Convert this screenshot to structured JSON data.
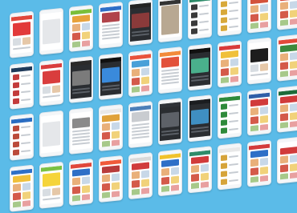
{
  "screens": [
    {
      "t": "promo",
      "bar": "#e0473b",
      "accent": "#e23a3a"
    },
    {
      "t": "blank",
      "bar": "#ffffff",
      "accent": "#e5e7ea"
    },
    {
      "t": "catalog",
      "bar": "#7bbf3a",
      "accent": "#e8a23a"
    },
    {
      "t": "article",
      "bar": "#2e6fc7",
      "accent": "#b0434a"
    },
    {
      "t": "video",
      "bar": "#222222",
      "accent": "#8a3a3a"
    },
    {
      "t": "photo",
      "bar": "#333333",
      "accent": "#b8a892"
    },
    {
      "t": "list",
      "bar": "#2e8c6a",
      "accent": "#3a3a3a"
    },
    {
      "t": "list",
      "bar": "#3d7fd4",
      "accent": "#d8a93a"
    },
    {
      "t": "catalog",
      "bar": "#2c64b8",
      "accent": "#d3523b"
    },
    {
      "t": "catalog",
      "bar": "#f0c22c",
      "accent": "#d64b3b"
    },
    {
      "t": "list",
      "bar": "#1f3a5a",
      "accent": "#c33b3b"
    },
    {
      "t": "promo",
      "bar": "#d93d3d",
      "accent": "#d93d3d"
    },
    {
      "t": "video",
      "bar": "#2a2a2a",
      "accent": "#7b7b7b"
    },
    {
      "t": "dark",
      "bar": "#111111",
      "accent": "#3a8adb"
    },
    {
      "t": "catalog",
      "bar": "#e8533c",
      "accent": "#4aa0d8"
    },
    {
      "t": "article",
      "bar": "#f28a3a",
      "accent": "#e2523b"
    },
    {
      "t": "dark",
      "bar": "#111111",
      "accent": "#4ab08c"
    },
    {
      "t": "catalog",
      "bar": "#d83b3b",
      "accent": "#f0c03a"
    },
    {
      "t": "promo",
      "bar": "#ffffff",
      "accent": "#1d1d1d"
    },
    {
      "t": "catalog",
      "bar": "#e24a3a",
      "accent": "#3d8a3d"
    },
    {
      "t": "list",
      "bar": "#2a6dc2",
      "accent": "#bb4a3a"
    },
    {
      "t": "blank",
      "bar": "#ffffff",
      "accent": "#e5e7ea"
    },
    {
      "t": "article",
      "bar": "#ffffff",
      "accent": "#8a8a8a"
    },
    {
      "t": "catalog",
      "bar": "#e8e8e8",
      "accent": "#e0a23a"
    },
    {
      "t": "article",
      "bar": "#4d7fb8",
      "accent": "#c9ccd0"
    },
    {
      "t": "dark",
      "bar": "#2f3338",
      "accent": "#5d6168"
    },
    {
      "t": "dark",
      "bar": "#1b1d20",
      "accent": "#3f8fc2"
    },
    {
      "t": "list",
      "bar": "#2e8a3a",
      "accent": "#2e8a3a"
    },
    {
      "t": "catalog",
      "bar": "#2f5fa8",
      "accent": "#d13b3b"
    },
    {
      "t": "catalog",
      "bar": "#1d6b3a",
      "accent": "#d13b3b"
    },
    {
      "t": "catalog",
      "bar": "#2e6fc7",
      "accent": "#f0c03a"
    },
    {
      "t": "promo",
      "bar": "#7ac143",
      "accent": "#f5d43a"
    },
    {
      "t": "catalog",
      "bar": "#e0473b",
      "accent": "#2e6fc7"
    },
    {
      "t": "catalog",
      "bar": "#f05a3a",
      "accent": "#b83b3b"
    },
    {
      "t": "catalog",
      "bar": "#d9d9d9",
      "accent": "#d13b3b"
    },
    {
      "t": "catalog",
      "bar": "#f0c22c",
      "accent": "#2e6fc7"
    },
    {
      "t": "catalog",
      "bar": "#2e8c6a",
      "accent": "#d13b3b"
    },
    {
      "t": "list",
      "bar": "#e8e8e8",
      "accent": "#d6a43a"
    },
    {
      "t": "catalog",
      "bar": "#d33b3b",
      "accent": "#2e6fc7"
    },
    {
      "t": "catalog",
      "bar": "#ffffff",
      "accent": "#d13b3b"
    }
  ]
}
